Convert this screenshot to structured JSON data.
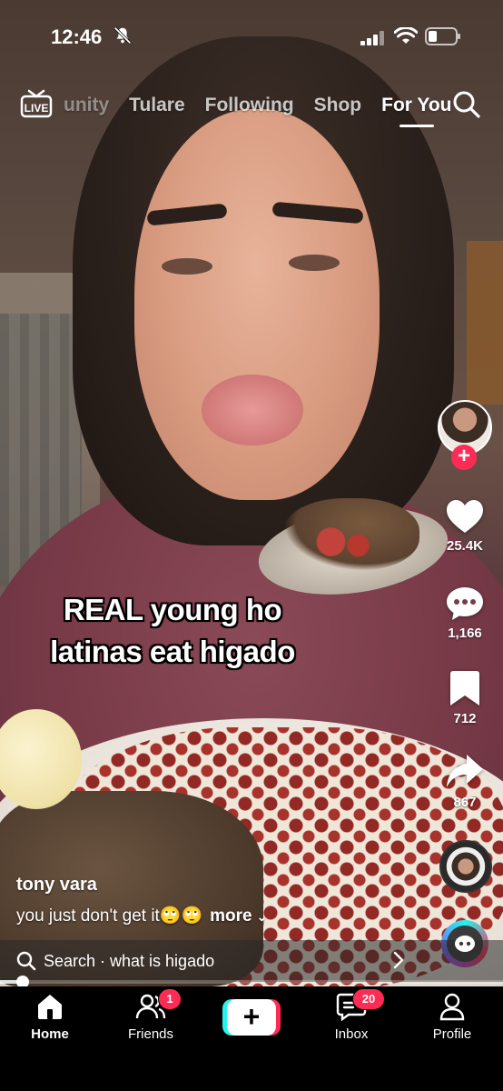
{
  "status_bar": {
    "time": "12:46",
    "icons": [
      "bell-slash-icon",
      "signal-icon",
      "wifi-icon",
      "battery-icon"
    ]
  },
  "top_nav": {
    "live_label": "LIVE",
    "tabs": [
      {
        "label": "unity"
      },
      {
        "label": "Tulare"
      },
      {
        "label": "Following"
      },
      {
        "label": "Shop"
      },
      {
        "label": "For You"
      }
    ],
    "active_tab": "For You",
    "search_icon": "search-icon"
  },
  "video": {
    "caption_line1": "REAL young ho",
    "caption_line2": "latinas eat higado"
  },
  "side_actions": {
    "like_count": "25.4K",
    "comment_count": "1,166",
    "save_count": "712",
    "share_count": "867"
  },
  "post": {
    "author": "tony vara",
    "description": "you just don't get it🙄🙄",
    "more_label": "more"
  },
  "search_suggestion": {
    "label": "Search",
    "query": "what is higado",
    "text": "Search · what is higado"
  },
  "playback": {
    "progress_fraction": 0.04
  },
  "bottom_nav": {
    "items": [
      {
        "label": "Home",
        "icon": "home-icon"
      },
      {
        "label": "Friends",
        "icon": "friends-icon",
        "badge": "1"
      },
      {
        "label": "",
        "icon": "plus-icon"
      },
      {
        "label": "Inbox",
        "icon": "inbox-icon",
        "badge": "20"
      },
      {
        "label": "Profile",
        "icon": "profile-icon"
      }
    ]
  },
  "colors": {
    "accent_red": "#fe2c55",
    "accent_cyan": "#25f4ee",
    "nav_background": "#000000"
  }
}
